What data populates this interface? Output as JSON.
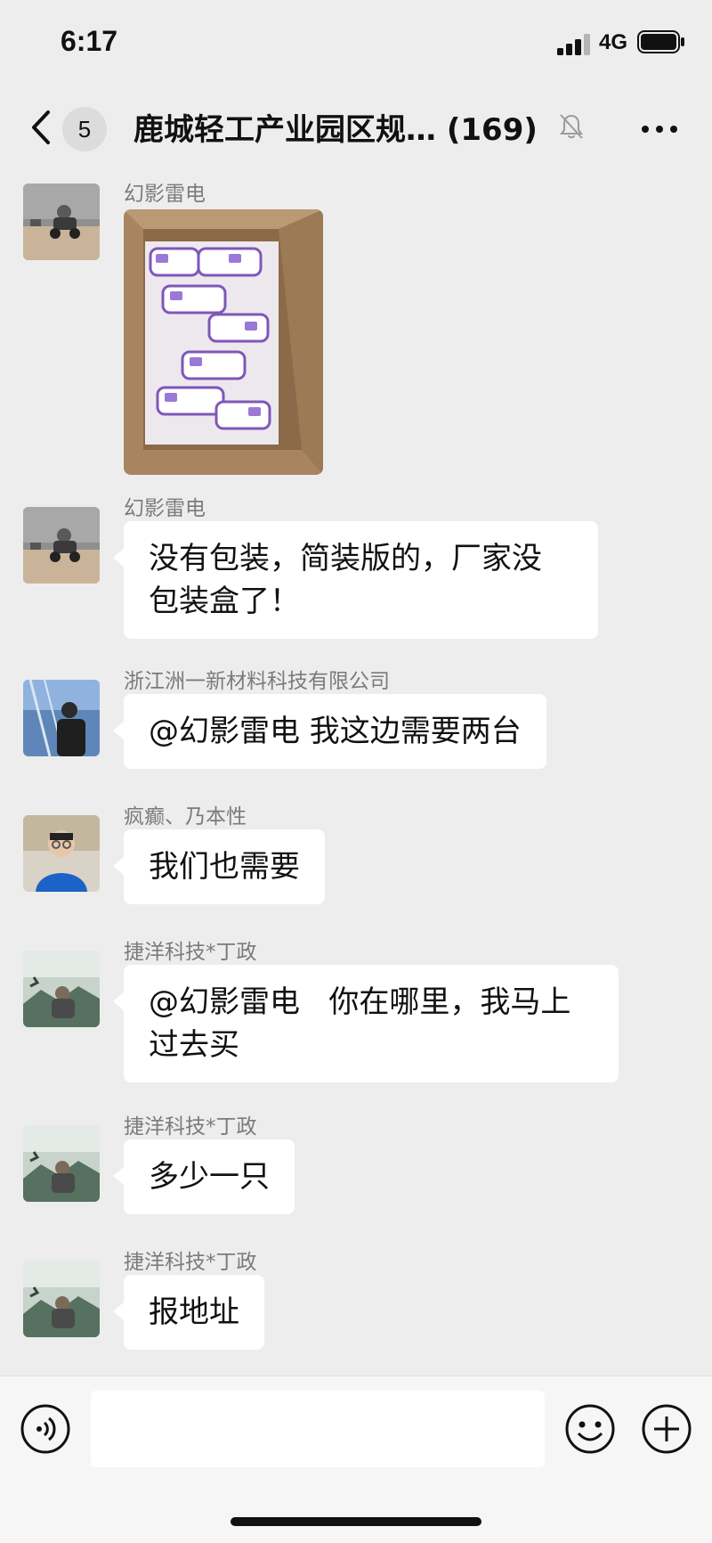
{
  "status_bar": {
    "time": "6:17",
    "network": "4G"
  },
  "nav": {
    "unread_count": "5",
    "title": "鹿城轻工产业园区规… (169)",
    "icons": {
      "back": "chevron-left-icon",
      "mute": "bell-slash-icon",
      "more": "ellipsis-icon"
    }
  },
  "messages": [
    {
      "sender": "幻影雷电",
      "type": "image",
      "image_desc": "thermometers-in-box"
    },
    {
      "sender": "幻影雷电",
      "type": "text",
      "lines": [
        "没有包装，简装版的，厂家没",
        "包装盒了！"
      ]
    },
    {
      "sender": "浙江洲一新材料科技有限公司",
      "type": "text",
      "lines": [
        "@幻影雷电 我这边需要两台"
      ]
    },
    {
      "sender": "疯癫、乃本性",
      "type": "text",
      "lines": [
        "我们也需要"
      ]
    },
    {
      "sender": "捷洋科技*丁政",
      "type": "text",
      "lines": [
        "@幻影雷电   你在哪里，我马上",
        "过去买"
      ]
    },
    {
      "sender": "捷洋科技*丁政",
      "type": "text",
      "lines": [
        "多少一只"
      ]
    },
    {
      "sender": "捷洋科技*丁政",
      "type": "text",
      "lines": [
        "报地址"
      ]
    }
  ],
  "input_bar": {
    "placeholder": "",
    "icons": {
      "voice": "voice-icon",
      "emoji": "emoji-icon",
      "plus": "plus-icon"
    }
  },
  "colors": {
    "background": "#ededed",
    "bubble": "#ffffff",
    "sender_name": "#7b7b7b"
  }
}
